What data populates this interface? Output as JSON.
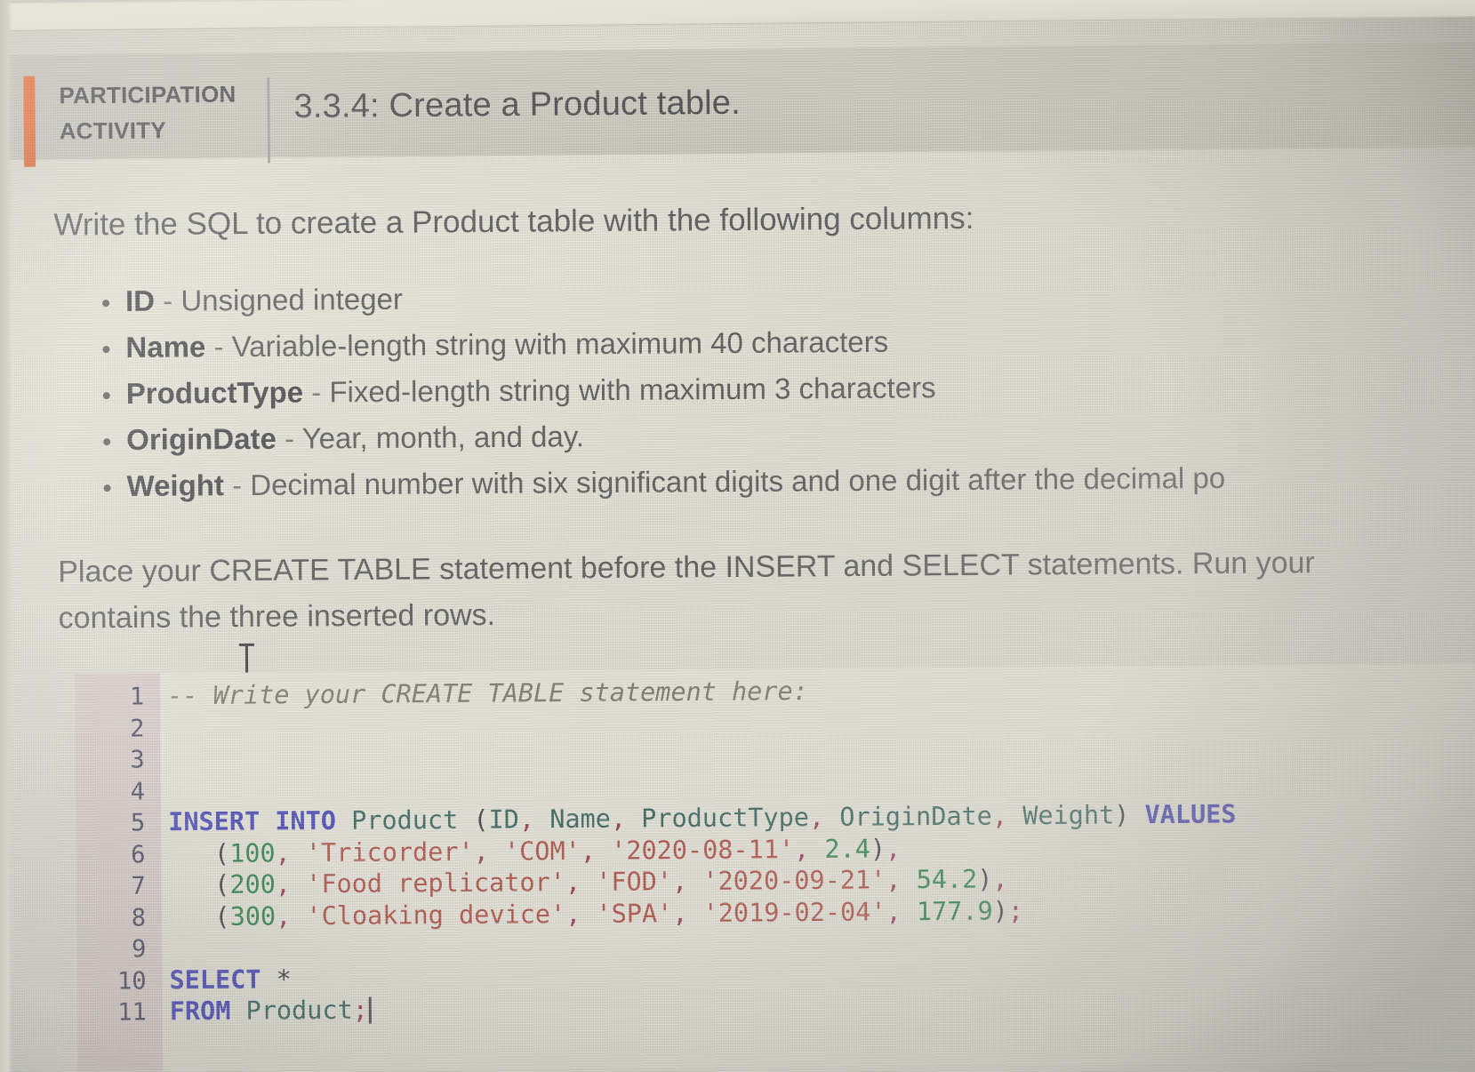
{
  "header": {
    "kicker_line1": "PARTICIPATION",
    "kicker_line2": "ACTIVITY",
    "title": "3.3.4: Create a Product table.",
    "marker_color": "#f4601d"
  },
  "body": {
    "lead": "Write the SQL to create a Product table with the following columns:",
    "bullets": [
      {
        "term": "ID",
        "dash": " - ",
        "desc": "Unsigned integer"
      },
      {
        "term": "Name",
        "dash": " - ",
        "desc": "Variable-length string with maximum 40 characters"
      },
      {
        "term": "ProductType",
        "dash": " - ",
        "desc": "Fixed-length string with maximum 3 characters"
      },
      {
        "term": "OriginDate",
        "dash": " - ",
        "desc": "Year, month, and day."
      },
      {
        "term": "Weight",
        "dash": " - ",
        "desc": "Decimal number with six significant digits and one digit after the decimal po"
      }
    ],
    "closing_line1": "Place your CREATE TABLE statement before the INSERT and SELECT statements. Run your",
    "closing_line2": "contains the three inserted rows."
  },
  "editor": {
    "lines": [
      {
        "number": "1",
        "tokens": [
          {
            "t": "comment",
            "s": "-- Write your CREATE TABLE statement here:"
          }
        ]
      },
      {
        "number": "2",
        "tokens": []
      },
      {
        "number": "3",
        "tokens": []
      },
      {
        "number": "4",
        "tokens": []
      },
      {
        "number": "5",
        "tokens": [
          {
            "t": "kw",
            "s": "INSERT INTO"
          },
          {
            "t": "plain",
            "s": " "
          },
          {
            "t": "id",
            "s": "Product"
          },
          {
            "t": "plain",
            "s": " ("
          },
          {
            "t": "id",
            "s": "ID"
          },
          {
            "t": "punc",
            "s": ","
          },
          {
            "t": "plain",
            "s": " "
          },
          {
            "t": "id",
            "s": "Name"
          },
          {
            "t": "punc",
            "s": ","
          },
          {
            "t": "plain",
            "s": " "
          },
          {
            "t": "id",
            "s": "ProductType"
          },
          {
            "t": "punc",
            "s": ","
          },
          {
            "t": "plain",
            "s": " "
          },
          {
            "t": "id",
            "s": "OriginDate"
          },
          {
            "t": "punc",
            "s": ","
          },
          {
            "t": "plain",
            "s": " "
          },
          {
            "t": "id",
            "s": "Weight"
          },
          {
            "t": "plain",
            "s": ") "
          },
          {
            "t": "kw",
            "s": "VALUES"
          }
        ]
      },
      {
        "number": "6",
        "tokens": [
          {
            "t": "plain",
            "s": "   ("
          },
          {
            "t": "num",
            "s": "100"
          },
          {
            "t": "punc",
            "s": ","
          },
          {
            "t": "plain",
            "s": " "
          },
          {
            "t": "str",
            "s": "'Tricorder'"
          },
          {
            "t": "punc",
            "s": ","
          },
          {
            "t": "plain",
            "s": " "
          },
          {
            "t": "str",
            "s": "'COM'"
          },
          {
            "t": "punc",
            "s": ","
          },
          {
            "t": "plain",
            "s": " "
          },
          {
            "t": "str",
            "s": "'2020-08-11'"
          },
          {
            "t": "punc",
            "s": ","
          },
          {
            "t": "plain",
            "s": " "
          },
          {
            "t": "num",
            "s": "2.4"
          },
          {
            "t": "plain",
            "s": ")"
          },
          {
            "t": "punc",
            "s": ","
          }
        ]
      },
      {
        "number": "7",
        "tokens": [
          {
            "t": "plain",
            "s": "   ("
          },
          {
            "t": "num",
            "s": "200"
          },
          {
            "t": "punc",
            "s": ","
          },
          {
            "t": "plain",
            "s": " "
          },
          {
            "t": "str",
            "s": "'Food replicator'"
          },
          {
            "t": "punc",
            "s": ","
          },
          {
            "t": "plain",
            "s": " "
          },
          {
            "t": "str",
            "s": "'FOD'"
          },
          {
            "t": "punc",
            "s": ","
          },
          {
            "t": "plain",
            "s": " "
          },
          {
            "t": "str",
            "s": "'2020-09-21'"
          },
          {
            "t": "punc",
            "s": ","
          },
          {
            "t": "plain",
            "s": " "
          },
          {
            "t": "num",
            "s": "54.2"
          },
          {
            "t": "plain",
            "s": ")"
          },
          {
            "t": "punc",
            "s": ","
          }
        ]
      },
      {
        "number": "8",
        "tokens": [
          {
            "t": "plain",
            "s": "   ("
          },
          {
            "t": "num",
            "s": "300"
          },
          {
            "t": "punc",
            "s": ","
          },
          {
            "t": "plain",
            "s": " "
          },
          {
            "t": "str",
            "s": "'Cloaking device'"
          },
          {
            "t": "punc",
            "s": ","
          },
          {
            "t": "plain",
            "s": " "
          },
          {
            "t": "str",
            "s": "'SPA'"
          },
          {
            "t": "punc",
            "s": ","
          },
          {
            "t": "plain",
            "s": " "
          },
          {
            "t": "str",
            "s": "'2019-02-04'"
          },
          {
            "t": "punc",
            "s": ","
          },
          {
            "t": "plain",
            "s": " "
          },
          {
            "t": "num",
            "s": "177.9"
          },
          {
            "t": "plain",
            "s": ")"
          },
          {
            "t": "punc",
            "s": ";"
          }
        ]
      },
      {
        "number": "9",
        "tokens": []
      },
      {
        "number": "10",
        "tokens": [
          {
            "t": "kw",
            "s": "SELECT"
          },
          {
            "t": "plain",
            "s": " *"
          }
        ]
      },
      {
        "number": "11",
        "tokens": [
          {
            "t": "kw",
            "s": "FROM"
          },
          {
            "t": "plain",
            "s": " "
          },
          {
            "t": "id",
            "s": "Product"
          },
          {
            "t": "punc",
            "s": ";"
          }
        ],
        "caret": true
      }
    ]
  },
  "cursor": {
    "type": "text-ibeam"
  }
}
